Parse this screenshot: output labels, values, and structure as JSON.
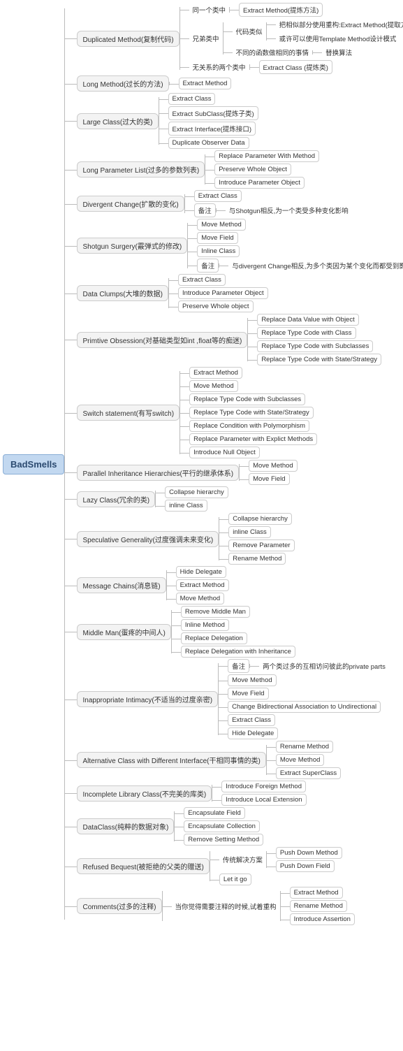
{
  "root": "BadSmells",
  "chart_data": {
    "type": "mindmap",
    "root": "BadSmells",
    "children": [
      {
        "label": "Duplicated Method(复制代码)",
        "children": [
          {
            "label": "同一个类中",
            "children": [
              {
                "label": "Extract Method(提炼方法)"
              }
            ]
          },
          {
            "label": "兄弟类中",
            "children": [
              {
                "label": "代码类似",
                "children": [
                  {
                    "label": "把相似部分使用重构:Extract Method(提取方法)"
                  },
                  {
                    "label": "或许可以使用Template Method设计模式"
                  }
                ]
              },
              {
                "label": "不同的函数做相同的事情",
                "children": [
                  {
                    "label": "替换算法"
                  }
                ]
              }
            ]
          },
          {
            "label": "无关系的两个类中",
            "children": [
              {
                "label": "Extract Class (提炼类)"
              }
            ]
          }
        ]
      },
      {
        "label": "Long Method(过长的方法)",
        "children": [
          {
            "label": "Extract Method"
          }
        ]
      },
      {
        "label": "Large Class(过大的类)",
        "children": [
          {
            "label": "Extract Class"
          },
          {
            "label": "Extract SubClass(提炼子类)"
          },
          {
            "label": "Extract Interface(提炼接口)"
          },
          {
            "label": "Duplicate Observer Data"
          }
        ]
      },
      {
        "label": "Long Parameter List(过多的参数列表)",
        "children": [
          {
            "label": "Replace Parameter With Method"
          },
          {
            "label": "Preserve Whole Object"
          },
          {
            "label": "Introduce Parameter Object"
          }
        ]
      },
      {
        "label": "Divergent Change(扩散的变化)",
        "children": [
          {
            "label": "Extract Class"
          },
          {
            "label": "备注",
            "children": [
              {
                "label": "与Shotgun相反,为一个类受多种变化影响"
              }
            ]
          }
        ]
      },
      {
        "label": "Shotgun Surgery(霰弹式的修改)",
        "children": [
          {
            "label": "Move Method"
          },
          {
            "label": "Move Field"
          },
          {
            "label": "Inline Class"
          },
          {
            "label": "备注",
            "children": [
              {
                "label": "与divergent Change相反,为多个类因为某个变化而都受到影响"
              }
            ]
          }
        ]
      },
      {
        "label": "Data Clumps(大堆的数据)",
        "children": [
          {
            "label": "Extract Class"
          },
          {
            "label": "Introduce Parameter Object"
          },
          {
            "label": "Preserve Whole object"
          }
        ]
      },
      {
        "label": "Primtive Obsession(对基础类型如int ,float等的痴迷)",
        "children": [
          {
            "label": "Replace Data Value with Object"
          },
          {
            "label": "Replace Type Code with Class"
          },
          {
            "label": "Replace Type Code with Subclasses"
          },
          {
            "label": "Replace Type Code with State/Strategy"
          }
        ]
      },
      {
        "label": "Switch statement(有写switch)",
        "children": [
          {
            "label": "Extract Method"
          },
          {
            "label": "Move Method"
          },
          {
            "label": "Replace Type Code with Subclasses"
          },
          {
            "label": "Replace Type Code with State/Strategy"
          },
          {
            "label": "Replace Condition with Polymorphism"
          },
          {
            "label": "Replace Parameter with Explict Methods"
          },
          {
            "label": "Introduce Null Object"
          }
        ]
      },
      {
        "label": "Parallel Inheritance Hierarchies(平行的继承体系)",
        "children": [
          {
            "label": "Move Method"
          },
          {
            "label": "Move Field"
          }
        ]
      },
      {
        "label": "Lazy Class(冗余的类)",
        "children": [
          {
            "label": "Collapse hierarchy"
          },
          {
            "label": "inline Class"
          }
        ]
      },
      {
        "label": "Speculative Generality(过度强调未来变化)",
        "children": [
          {
            "label": "Collapse hierarchy"
          },
          {
            "label": "inline Class"
          },
          {
            "label": "Remove Parameter"
          },
          {
            "label": "Rename Method"
          }
        ]
      },
      {
        "label": "Message Chains(消息链)",
        "children": [
          {
            "label": "Hide Delegate"
          },
          {
            "label": "Extract Method"
          },
          {
            "label": "Move Method"
          }
        ]
      },
      {
        "label": "Middle Man(蛋疼的中间人)",
        "children": [
          {
            "label": "Remove Middle Man"
          },
          {
            "label": "Inline Method"
          },
          {
            "label": "Replace Delegation"
          },
          {
            "label": "Replace Delegation with Inheritance"
          }
        ]
      },
      {
        "label": "Inappropriate Intimacy(不适当的过度亲密)",
        "children": [
          {
            "label": "备注",
            "children": [
              {
                "label": "两个类过多的互相访问彼此的private parts"
              }
            ]
          },
          {
            "label": "Move Method"
          },
          {
            "label": "Move Field"
          },
          {
            "label": "Change Bidirectional Association to Undirectional"
          },
          {
            "label": "Extract Class"
          },
          {
            "label": "Hide Delegate"
          }
        ]
      },
      {
        "label": "Alternative Class with Different Interface(干相同事情的类)",
        "children": [
          {
            "label": "Rename Method"
          },
          {
            "label": "Move Method"
          },
          {
            "label": "Extract SuperClass"
          }
        ]
      },
      {
        "label": "Incomplete Library Class(不完美的库类)",
        "children": [
          {
            "label": "Introduce Foreign Method"
          },
          {
            "label": "Introduce Local Extension"
          }
        ]
      },
      {
        "label": "DataClass(纯粹的数据对象)",
        "children": [
          {
            "label": "Encapsulate Field"
          },
          {
            "label": "Encapsulate Collection"
          },
          {
            "label": "Remove Setting Method"
          }
        ]
      },
      {
        "label": "Refused Bequest(被拒绝的父类的赠送)",
        "children": [
          {
            "label": "传统解决方案",
            "children": [
              {
                "label": "Push Down Method"
              },
              {
                "label": "Push Down Field"
              }
            ]
          },
          {
            "label": "Let it go"
          }
        ]
      },
      {
        "label": "Comments(过多的注释)",
        "children": [
          {
            "label": "当你觉得需要注释的时候,试着重构",
            "children": [
              {
                "label": "Extract Method"
              },
              {
                "label": "Rename Method"
              },
              {
                "label": "Introduce Assertion"
              }
            ]
          }
        ]
      }
    ]
  },
  "n": {
    "n1": "Duplicated Method(复制代码)",
    "n1a": "同一个类中",
    "n1a1": "Extract Method(提炼方法)",
    "n1b": "兄弟类中",
    "n1b1": "代码类似",
    "n1b1a": "把相似部分使用重构:Extract Method(提取方法)",
    "n1b1b": "或许可以使用Template Method设计模式",
    "n1b2": "不同的函数做相同的事情",
    "n1b2a": "替换算法",
    "n1c": "无关系的两个类中",
    "n1c1": "Extract Class (提炼类)",
    "n2": "Long Method(过长的方法)",
    "n2a": "Extract Method",
    "n3": "Large Class(过大的类)",
    "n3a": "Extract Class",
    "n3b": "Extract SubClass(提炼子类)",
    "n3c": "Extract Interface(提炼接口)",
    "n3d": "Duplicate Observer Data",
    "n4": "Long Parameter List(过多的参数列表)",
    "n4a": "Replace Parameter With Method",
    "n4b": "Preserve Whole Object",
    "n4c": "Introduce Parameter Object",
    "n5": "Divergent Change(扩散的变化)",
    "n5a": "Extract Class",
    "n5b": "备注",
    "n5b1": "与Shotgun相反,为一个类受多种变化影响",
    "n6": "Shotgun Surgery(霰弹式的修改)",
    "n6a": "Move Method",
    "n6b": "Move Field",
    "n6c": "Inline Class",
    "n6d": "备注",
    "n6d1": "与divergent Change相反,为多个类因为某个变化而都受到影响",
    "n7": "Data Clumps(大堆的数据)",
    "n7a": "Extract Class",
    "n7b": "Introduce Parameter Object",
    "n7c": "Preserve Whole object",
    "n8": "Primtive Obsession(对基础类型如int ,float等的痴迷)",
    "n8a": "Replace Data Value with Object",
    "n8b": "Replace Type Code with Class",
    "n8c": "Replace Type Code with Subclasses",
    "n8d": "Replace Type Code with State/Strategy",
    "n9": "Switch statement(有写switch)",
    "n9a": "Extract Method",
    "n9b": "Move Method",
    "n9c": "Replace Type Code with Subclasses",
    "n9d": "Replace Type Code with State/Strategy",
    "n9e": "Replace Condition with Polymorphism",
    "n9f": "Replace Parameter with Explict Methods",
    "n9g": "Introduce Null Object",
    "n10": "Parallel Inheritance Hierarchies(平行的继承体系)",
    "n10a": "Move Method",
    "n10b": "Move Field",
    "n11": "Lazy Class(冗余的类)",
    "n11a": "Collapse hierarchy",
    "n11b": "inline Class",
    "n12": "Speculative Generality(过度强调未来变化)",
    "n12a": "Collapse hierarchy",
    "n12b": "inline Class",
    "n12c": "Remove Parameter",
    "n12d": "Rename Method",
    "n13": "Message Chains(消息链)",
    "n13a": "Hide Delegate",
    "n13b": "Extract Method",
    "n13c": "Move Method",
    "n14": "Middle Man(蛋疼的中间人)",
    "n14a": "Remove Middle Man",
    "n14b": "Inline Method",
    "n14c": "Replace Delegation",
    "n14d": "Replace Delegation with Inheritance",
    "n15": "Inappropriate Intimacy(不适当的过度亲密)",
    "n15a": "备注",
    "n15a1": "两个类过多的互相访问彼此的private parts",
    "n15b": "Move Method",
    "n15c": "Move Field",
    "n15d": "Change Bidirectional Association to Undirectional",
    "n15e": "Extract Class",
    "n15f": "Hide Delegate",
    "n16": "Alternative Class with Different Interface(干相同事情的类)",
    "n16a": "Rename Method",
    "n16b": "Move Method",
    "n16c": "Extract SuperClass",
    "n17": "Incomplete Library Class(不完美的库类)",
    "n17a": "Introduce Foreign Method",
    "n17b": "Introduce Local Extension",
    "n18": "DataClass(纯粹的数据对象)",
    "n18a": "Encapsulate Field",
    "n18b": "Encapsulate Collection",
    "n18c": "Remove Setting Method",
    "n19": "Refused Bequest(被拒绝的父类的赠送)",
    "n19a": "传统解决方案",
    "n19a1": "Push Down Method",
    "n19a2": "Push Down Field",
    "n19b": "Let it go",
    "n20": "Comments(过多的注释)",
    "n20a": "当你觉得需要注释的时候,试着重构",
    "n20a1": "Extract Method",
    "n20a2": "Rename Method",
    "n20a3": "Introduce Assertion"
  }
}
